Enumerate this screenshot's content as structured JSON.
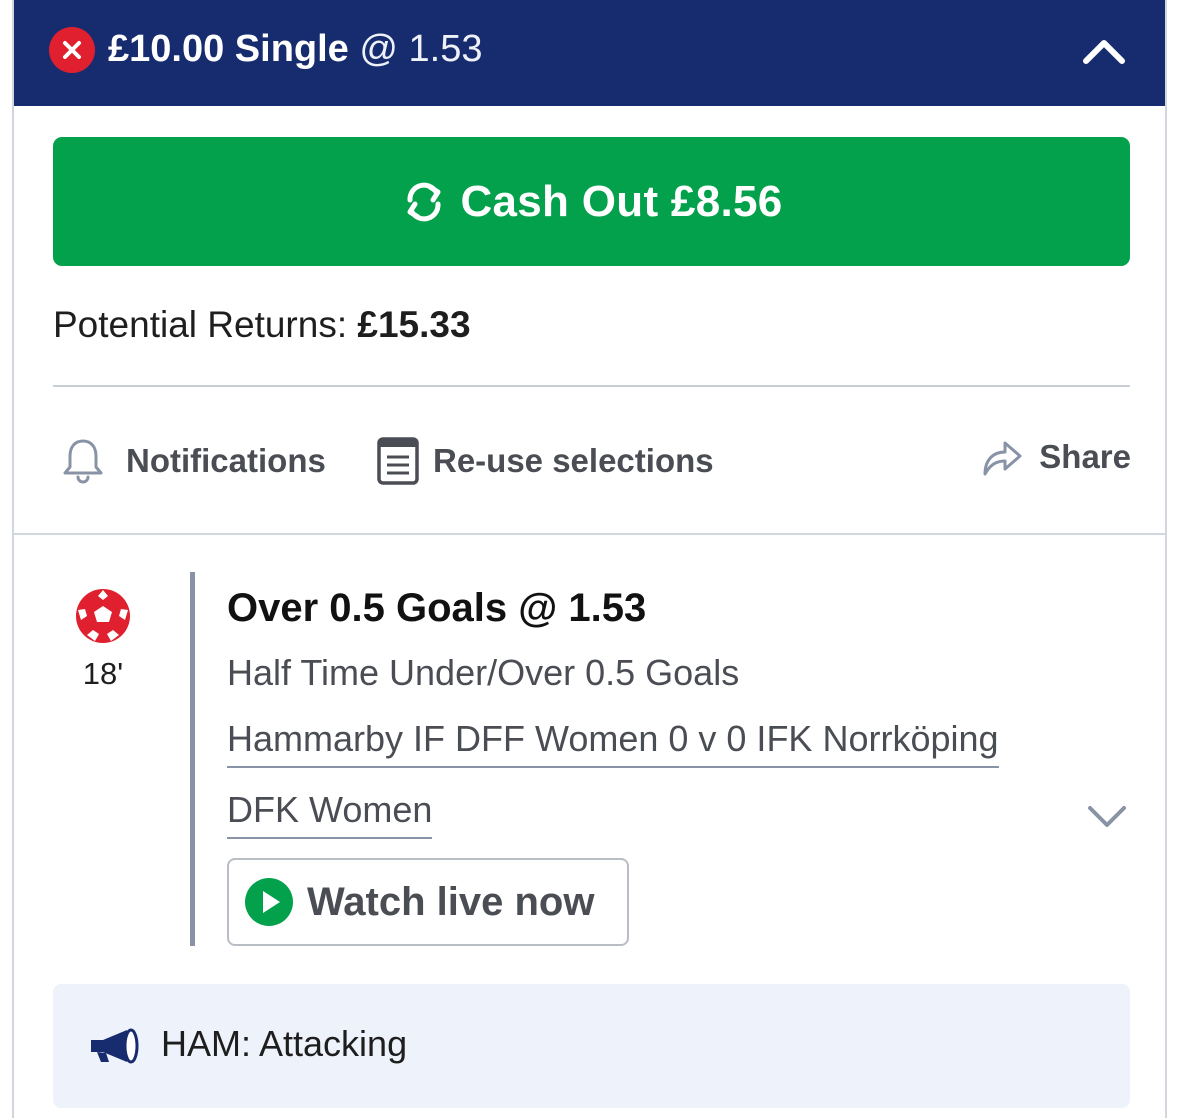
{
  "header": {
    "stake_type": "£10.00 Single",
    "odds": "@ 1.53",
    "status_icon": "cross-icon",
    "collapse_icon": "chevron-up-icon",
    "background_color": "#172c6e",
    "status_color": "#e0202e"
  },
  "cashout": {
    "label": "Cash Out £8.56",
    "icon": "refresh-icon",
    "color": "#03a14b"
  },
  "returns": {
    "label": "Potential Returns:",
    "amount": "£15.33"
  },
  "actions": {
    "notifications": {
      "label": "Notifications",
      "icon": "bell-icon"
    },
    "reuse": {
      "label": "Re-use selections",
      "icon": "document-icon"
    },
    "share": {
      "label": "Share",
      "icon": "share-arrow-icon"
    }
  },
  "selection": {
    "sport_icon": "football-icon",
    "match_time": "18'",
    "title": "Over 0.5 Goals @ 1.53",
    "market": "Half Time Under/Over 0.5 Goals",
    "event_line1": "Hammarby IF DFF Women 0 v 0 IFK Norrköping",
    "event_line2": "DFK Women",
    "expand_icon": "chevron-down-icon",
    "watch_label": "Watch live now",
    "watch_icon": "play-icon"
  },
  "commentary": {
    "icon": "megaphone-icon",
    "text": "HAM: Attacking"
  }
}
